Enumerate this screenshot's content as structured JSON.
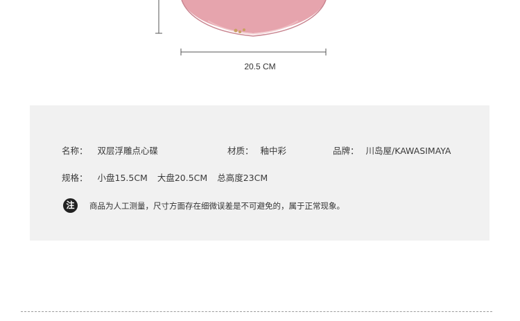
{
  "dimension": {
    "width_label": "20.5 CM"
  },
  "spec": {
    "name_label": "名称：",
    "name_value": "双层浮雕点心碟",
    "material_label": "材质：",
    "material_value": "釉中彩",
    "brand_label": "品牌：",
    "brand_value": "川岛屋/KAWASIMAYA",
    "size_label": "规格：",
    "size_small": "小盘15.5CM",
    "size_large": "大盘20.5CM",
    "size_total": "总高度23CM",
    "notice_icon": "注",
    "notice_text": "商品为人工测量，尺寸方面存在细微误差是不可避免的，属于正常现象。"
  },
  "colors": {
    "plate_pink": "#e3a0a8",
    "plate_rim": "#d98e98",
    "spec_bg": "#f1f1f1"
  }
}
